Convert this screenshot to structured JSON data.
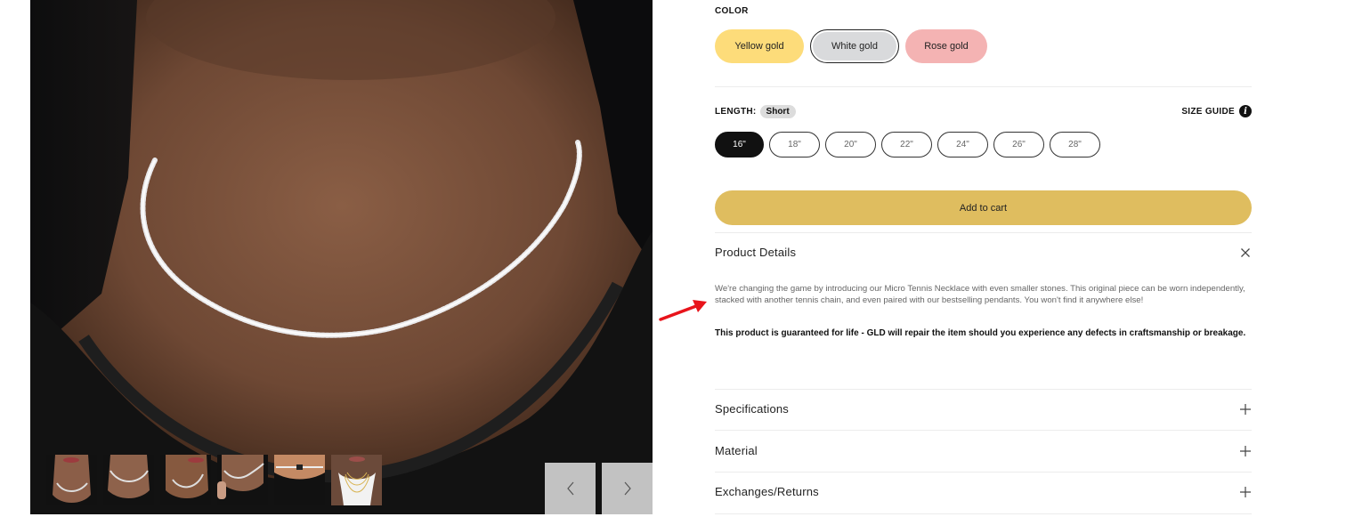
{
  "gallery": {
    "hero_alt": "Model wearing micro tennis necklace",
    "thumbnails": [
      {
        "label": "thumbnail-1"
      },
      {
        "label": "thumbnail-2"
      },
      {
        "label": "thumbnail-3"
      },
      {
        "label": "thumbnail-4"
      },
      {
        "label": "thumbnail-5"
      },
      {
        "label": "thumbnail-6"
      }
    ],
    "prev_icon": "chevron-left-icon",
    "next_icon": "chevron-right-icon"
  },
  "color": {
    "label": "COLOR",
    "options": [
      {
        "label": "Yellow gold",
        "color": "#fddc7a",
        "selected": false
      },
      {
        "label": "White gold",
        "color": "#d9dadc",
        "selected": true
      },
      {
        "label": "Rose gold",
        "color": "#f4b3b3",
        "selected": false
      }
    ]
  },
  "length": {
    "label": "LENGTH:",
    "badge": "Short",
    "size_guide_label": "SIZE GUIDE",
    "size_guide_icon": "info-icon",
    "options": [
      {
        "label": "16\"",
        "selected": true
      },
      {
        "label": "18\"",
        "selected": false
      },
      {
        "label": "20\"",
        "selected": false
      },
      {
        "label": "22\"",
        "selected": false
      },
      {
        "label": "24\"",
        "selected": false
      },
      {
        "label": "26\"",
        "selected": false
      },
      {
        "label": "28\"",
        "selected": false
      }
    ]
  },
  "cart": {
    "add_label": "Add to cart",
    "accent": "#dfbd5f"
  },
  "accordion": {
    "product_details": {
      "title": "Product Details",
      "expanded": true,
      "icon": "close-icon",
      "description": "We're changing the game by introducing our Micro Tennis Necklace with even smaller stones. This original piece can be worn independently, stacked with another tennis chain, and even paired with our bestselling pendants. You won't find it anywhere else!",
      "guarantee": "This product is guaranteed for life - GLD will repair the item should you experience any defects in craftsmanship or breakage."
    },
    "sections": [
      {
        "title": "Specifications",
        "icon": "plus-icon",
        "expanded": false
      },
      {
        "title": "Material",
        "icon": "plus-icon",
        "expanded": false
      },
      {
        "title": "Exchanges/Returns",
        "icon": "plus-icon",
        "expanded": false
      }
    ]
  },
  "annotation": {
    "arrow_color": "#e8141b"
  }
}
